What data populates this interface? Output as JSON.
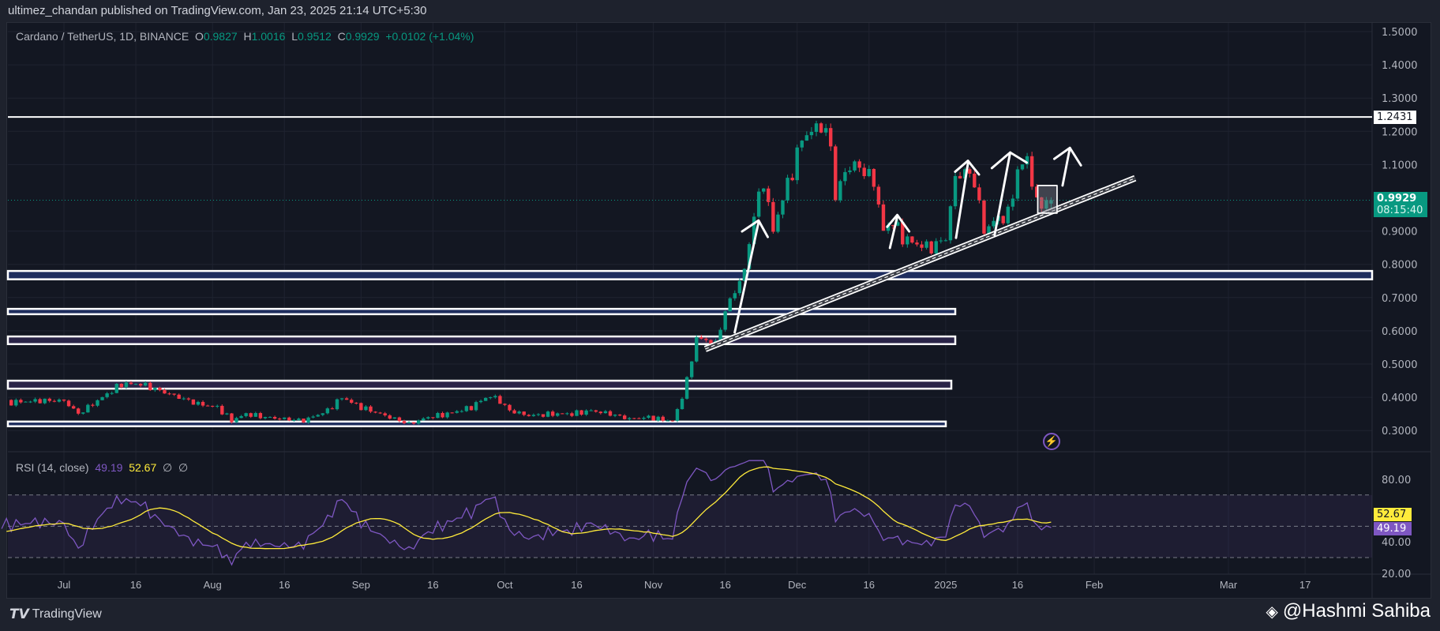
{
  "header": {
    "published": "ultimez_chandan published on TradingView.com, Jan 23, 2025 21:14 UTC+5:30"
  },
  "legend": {
    "symbol": "Cardano / TetherUS, 1D, BINANCE",
    "o_label": "O",
    "o": "0.9827",
    "h_label": "H",
    "h": "1.0016",
    "l_label": "L",
    "l": "0.9512",
    "c_label": "C",
    "c": "0.9929",
    "change": "+0.0102 (+1.04%)"
  },
  "rsi_legend": {
    "title": "RSI (14, close)",
    "rsi": "49.19",
    "ma": "52.67",
    "n1": "∅",
    "n2": "∅"
  },
  "price_tags": {
    "level": "1.2431",
    "last": "0.9929",
    "countdown": "08:15:40",
    "rsi": "49.19",
    "rsi_ma": "52.67"
  },
  "footer": {
    "brand": "TradingView",
    "watermark": "@Hashmi Sahiba"
  },
  "colors": {
    "up": "#089981",
    "down": "#f23645",
    "rsi": "#7e57c2",
    "rsi_ma": "#ffeb3b",
    "zone_blue": "#1e2d5e",
    "zone_purple": "#2a2448"
  },
  "chart_data": {
    "type": "candlestick",
    "title": "Cardano / TetherUS, 1D, BINANCE",
    "x_ticks": [
      {
        "label": "Jul",
        "day": 0
      },
      {
        "label": "16",
        "day": 15
      },
      {
        "label": "Aug",
        "day": 31
      },
      {
        "label": "16",
        "day": 46
      },
      {
        "label": "Sep",
        "day": 62
      },
      {
        "label": "16",
        "day": 77
      },
      {
        "label": "Oct",
        "day": 92
      },
      {
        "label": "16",
        "day": 107
      },
      {
        "label": "Nov",
        "day": 123
      },
      {
        "label": "16",
        "day": 138
      },
      {
        "label": "Dec",
        "day": 153
      },
      {
        "label": "16",
        "day": 168
      },
      {
        "label": "2025",
        "day": 184
      },
      {
        "label": "16",
        "day": 199
      },
      {
        "label": "Feb",
        "day": 215
      },
      {
        "label": "Mar",
        "day": 243
      },
      {
        "label": "17",
        "day": 259
      }
    ],
    "y_ticks": [
      "1.5000",
      "1.4000",
      "1.3000",
      "1.2000",
      "1.1000",
      "0.9000",
      "0.8000",
      "0.7000",
      "0.6000",
      "0.5000",
      "0.4000",
      "0.3000"
    ],
    "ylim": [
      0.27,
      1.52
    ],
    "rsi_ticks": [
      "80.00",
      "40.00",
      "20.00"
    ],
    "rsi_bands": [
      70,
      50,
      30
    ],
    "close_anchors": [
      [
        -40,
        0.4
      ],
      [
        -25,
        0.37
      ],
      [
        -11,
        0.385
      ],
      [
        -5,
        0.39
      ],
      [
        0,
        0.39
      ],
      [
        3,
        0.35
      ],
      [
        5,
        0.37
      ],
      [
        8,
        0.4
      ],
      [
        12,
        0.44
      ],
      [
        16,
        0.44
      ],
      [
        20,
        0.42
      ],
      [
        24,
        0.4
      ],
      [
        28,
        0.38
      ],
      [
        32,
        0.37
      ],
      [
        35,
        0.33
      ],
      [
        38,
        0.35
      ],
      [
        42,
        0.34
      ],
      [
        46,
        0.335
      ],
      [
        50,
        0.33
      ],
      [
        55,
        0.36
      ],
      [
        58,
        0.4
      ],
      [
        62,
        0.37
      ],
      [
        66,
        0.35
      ],
      [
        70,
        0.33
      ],
      [
        72,
        0.32
      ],
      [
        76,
        0.34
      ],
      [
        80,
        0.35
      ],
      [
        85,
        0.37
      ],
      [
        88,
        0.4
      ],
      [
        90,
        0.4
      ],
      [
        93,
        0.36
      ],
      [
        97,
        0.345
      ],
      [
        102,
        0.35
      ],
      [
        106,
        0.35
      ],
      [
        110,
        0.36
      ],
      [
        114,
        0.35
      ],
      [
        118,
        0.335
      ],
      [
        122,
        0.34
      ],
      [
        126,
        0.33
      ],
      [
        127,
        0.33
      ],
      [
        128,
        0.36
      ],
      [
        130,
        0.45
      ],
      [
        132,
        0.58
      ],
      [
        134,
        0.57
      ],
      [
        136,
        0.56
      ],
      [
        138,
        0.66
      ],
      [
        140,
        0.72
      ],
      [
        142,
        0.78
      ],
      [
        144,
        0.95
      ],
      [
        146,
        1.05
      ],
      [
        148,
        0.9
      ],
      [
        150,
        1.0
      ],
      [
        152,
        1.08
      ],
      [
        154,
        1.18
      ],
      [
        156,
        1.2
      ],
      [
        158,
        1.22
      ],
      [
        160,
        1.16
      ],
      [
        161,
        1.0
      ],
      [
        163,
        1.08
      ],
      [
        165,
        1.1
      ],
      [
        167,
        1.08
      ],
      [
        169,
        1.05
      ],
      [
        171,
        0.9
      ],
      [
        173,
        0.93
      ],
      [
        175,
        0.88
      ],
      [
        178,
        0.86
      ],
      [
        181,
        0.85
      ],
      [
        184,
        0.88
      ],
      [
        186,
        1.06
      ],
      [
        188,
        1.08
      ],
      [
        190,
        1.05
      ],
      [
        192,
        0.9
      ],
      [
        194,
        0.93
      ],
      [
        197,
        0.95
      ],
      [
        199,
        1.08
      ],
      [
        201,
        1.12
      ],
      [
        202,
        1.05
      ],
      [
        203,
        0.98
      ],
      [
        206,
        0.9929
      ]
    ],
    "first_visible_day": -11,
    "last_candle": {
      "open": 0.9827,
      "high": 1.0016,
      "low": 0.9512,
      "close": 0.9929
    },
    "horizontal_levels": [
      1.2431
    ],
    "zones": [
      {
        "from": 0.755,
        "to": 0.78,
        "color": "blue",
        "extends": "right"
      },
      {
        "from": 0.65,
        "to": 0.666,
        "color": "blue"
      },
      {
        "from": 0.56,
        "to": 0.583,
        "color": "purple"
      },
      {
        "from": 0.426,
        "to": 0.45,
        "color": "purple"
      },
      {
        "from": 0.313,
        "to": 0.327,
        "color": "blue"
      }
    ],
    "rsi_period": 14,
    "rsi_last": 49.19,
    "rsi_ma_last": 52.67
  }
}
